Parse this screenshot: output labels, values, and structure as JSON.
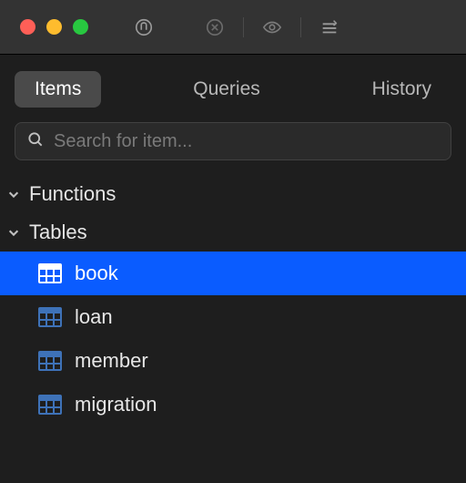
{
  "tabs": {
    "items": "Items",
    "queries": "Queries",
    "history": "History"
  },
  "search": {
    "placeholder": "Search for item..."
  },
  "groups": {
    "functions": "Functions",
    "tables": "Tables"
  },
  "tables": {
    "items": [
      {
        "label": "book",
        "selected": true
      },
      {
        "label": "loan",
        "selected": false
      },
      {
        "label": "member",
        "selected": false
      },
      {
        "label": "migration",
        "selected": false
      }
    ]
  }
}
